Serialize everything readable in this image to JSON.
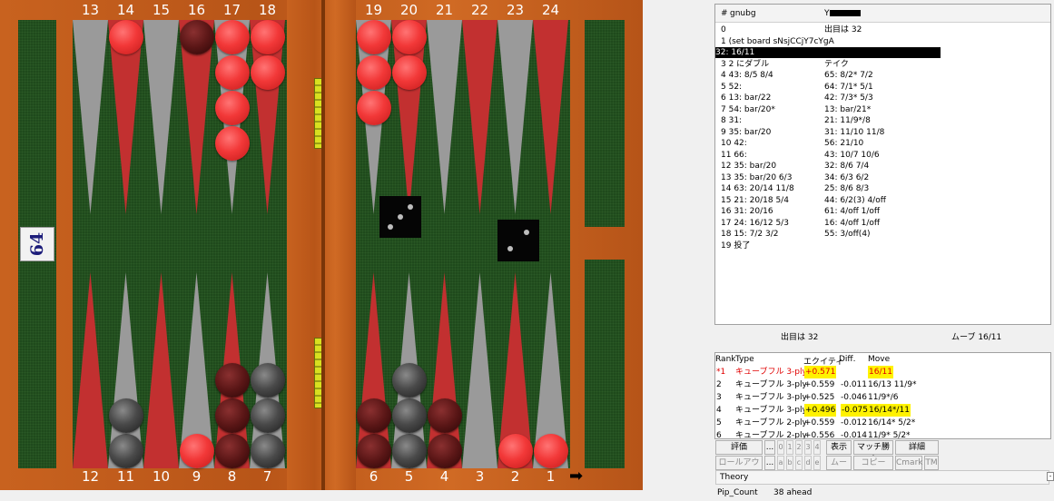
{
  "board": {
    "top_numbers": [
      "13",
      "14",
      "15",
      "16",
      "17",
      "18",
      "19",
      "20",
      "21",
      "22",
      "23",
      "24"
    ],
    "bottom_numbers": [
      "12",
      "11",
      "10",
      "9",
      "8",
      "7",
      "6",
      "5",
      "4",
      "3",
      "2",
      "1"
    ],
    "cube_value": "64",
    "dice": [
      3,
      2
    ],
    "arrow": "➡"
  },
  "movelist": {
    "header_num": "#",
    "header_player1": "gnubg",
    "header_player2": "Y",
    "rows": [
      {
        "left": "0",
        "right": "出目は 32"
      },
      {
        "left": "1  (set board sNsjCCjY7cYgA",
        "right": ""
      },
      {
        "left": "2",
        "right": "32: 16/11"
      },
      {
        "left": "3  2 にダブル",
        "right": "テイク"
      },
      {
        "left": "4  43: 8/5 8/4",
        "right": "65: 8/2* 7/2"
      },
      {
        "left": "5  52:",
        "right": "64: 7/1* 5/1"
      },
      {
        "left": "6  13: bar/22",
        "right": "42: 7/3* 5/3"
      },
      {
        "left": "7  54: bar/20*",
        "right": "13: bar/21*"
      },
      {
        "left": "8  31:",
        "right": "21: 11/9*/8"
      },
      {
        "left": "9  35: bar/20",
        "right": "31: 11/10 11/8"
      },
      {
        "left": "10  42:",
        "right": "56: 21/10"
      },
      {
        "left": "11  66:",
        "right": "43: 10/7 10/6"
      },
      {
        "left": "12  35: bar/20",
        "right": "32: 8/6 7/4"
      },
      {
        "left": "13  35: bar/20 6/3",
        "right": "34: 6/3 6/2"
      },
      {
        "left": "14  63: 20/14 11/8",
        "right": "25: 8/6 8/3"
      },
      {
        "left": "15  21: 20/18 5/4",
        "right": "44: 6/2(3) 4/off"
      },
      {
        "left": "16  31: 20/16",
        "right": "61: 4/off 1/off"
      },
      {
        "left": "17  24: 16/12 5/3",
        "right": "16: 4/off 1/off"
      },
      {
        "left": "18  15: 7/2 3/2",
        "right": "55: 3/off(4)"
      },
      {
        "left": "19  投了",
        "right": ""
      }
    ],
    "selected_index": 2
  },
  "status": {
    "left": "出目は 32",
    "right": "ムーブ 16/11"
  },
  "analysis": {
    "headers": {
      "rank": "Rank",
      "type": "Type",
      "equity": "エクイティ",
      "diff": "Diff.",
      "move": "Move"
    },
    "rows": [
      {
        "rank": "*1",
        "type": "キューブフル 3-ply",
        "equity": "+0.571",
        "diff": "",
        "move": "16/11"
      },
      {
        "rank": "2",
        "type": "キューブフル 3-ply",
        "equity": "+0.559",
        "diff": "-0.011",
        "move": "16/13 11/9*"
      },
      {
        "rank": "3",
        "type": "キューブフル 3-ply",
        "equity": "+0.525",
        "diff": "-0.046",
        "move": "11/9*/6"
      },
      {
        "rank": "4",
        "type": "キューブフル 3-ply",
        "equity": "+0.496",
        "diff": "-0.075",
        "move": "16/14*/11"
      },
      {
        "rank": "5",
        "type": "キューブフル 2-ply",
        "equity": "+0.559",
        "diff": "-0.012",
        "move": "16/14* 5/2*"
      },
      {
        "rank": "6",
        "type": "キューブフル 2-ply",
        "equity": "+0.556",
        "diff": "-0.014",
        "move": "11/9* 5/2*"
      }
    ]
  },
  "buttons_row1": {
    "eval": "評価",
    "dots": "...",
    "plies": [
      "0",
      "1",
      "2",
      "3",
      "4"
    ],
    "show": "表示",
    "match_eq": "マッチ勝率",
    "detail": "詳細"
  },
  "buttons_row2": {
    "rollout": "ロールアウト",
    "dots": "...",
    "letters": [
      "a",
      "b",
      "c",
      "d",
      "e"
    ],
    "move": "ムーブ",
    "copy": "コピー",
    "cmark": "Cmark",
    "tm": "TM"
  },
  "theory_tab": "Theory",
  "pip": {
    "label": "Pip_Count",
    "value": "38 ahead"
  },
  "colors": {
    "board_wood": "#b4561a",
    "felt": "#1f4a1c",
    "red_point": "#c23030",
    "gray_point": "#9a9a9a",
    "highlight": "#fff200",
    "selected": "#000000"
  }
}
